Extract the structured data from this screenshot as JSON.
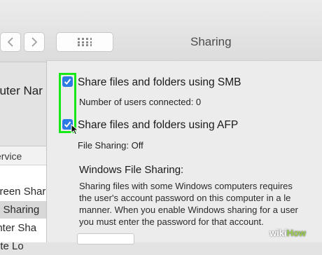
{
  "window": {
    "title": "Sharing"
  },
  "computer_name_label": "puter Nar",
  "service_list": {
    "header": "ervice",
    "items": [
      {
        "label": "creen Shar",
        "selected": false
      },
      {
        "label": "e Sharing",
        "selected": true
      },
      {
        "label": "inter Sha",
        "selected": false
      },
      {
        "label": "ote Lo",
        "selected": false
      }
    ]
  },
  "options": {
    "smb": {
      "label": "Share files and folders using SMB",
      "checked": true
    },
    "smb_users": "Number of users connected: 0",
    "afp": {
      "label": "Share files and folders using AFP",
      "checked": true
    },
    "file_sharing_status": "File Sharing: Off"
  },
  "windows_sharing": {
    "title": "Windows File Sharing:",
    "lines": [
      "Sharing files with some Windows computers requires",
      "the user's account password on this computer in a le",
      "manner.  When you enable Windows sharing for a user",
      "you must enter the password for that account."
    ]
  },
  "watermark": {
    "part1": "wiki",
    "part2": "How"
  },
  "colors": {
    "highlight": "#17e817",
    "checkbox": "#2c7be5"
  },
  "icons": {
    "back": "chevron-left-icon",
    "forward": "chevron-right-icon",
    "show_all": "grid-icon",
    "cursor": "mouse-pointer-icon"
  }
}
